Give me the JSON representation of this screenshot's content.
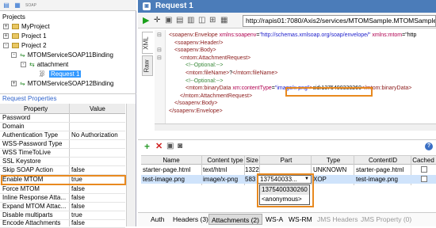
{
  "navigator": {
    "logo": "SOAP",
    "projects_label": "Projects",
    "tree": [
      {
        "label": "MyProject",
        "expander": "+"
      },
      {
        "label": "Project 1",
        "expander": "+"
      },
      {
        "label": "Project 2",
        "expander": "-"
      },
      {
        "label": "MTOMServiceSOAP11Binding",
        "expander": "-"
      },
      {
        "label": "attachment",
        "expander": "-"
      },
      {
        "label": "Request 1",
        "expander": ""
      },
      {
        "label": "MTOMServiceSOAP12Binding",
        "expander": "+"
      }
    ]
  },
  "properties": {
    "title": "Request Properties",
    "col_property": "Property",
    "col_value": "Value",
    "rows": [
      {
        "name": "Password",
        "value": ""
      },
      {
        "name": "Domain",
        "value": ""
      },
      {
        "name": "Authentication Type",
        "value": "No Authorization"
      },
      {
        "name": "WSS-Password Type",
        "value": ""
      },
      {
        "name": "WSS TimeToLive",
        "value": ""
      },
      {
        "name": "SSL Keystore",
        "value": ""
      },
      {
        "name": "Skip SOAP Action",
        "value": "false"
      },
      {
        "name": "Enable MTOM",
        "value": "true"
      },
      {
        "name": "Force MTOM",
        "value": "false"
      },
      {
        "name": "Inline Response Atta...",
        "value": "false"
      },
      {
        "name": "Expand MTOM Attac...",
        "value": "false"
      },
      {
        "name": "Disable multiparts",
        "value": "true"
      },
      {
        "name": "Encode Attachments",
        "value": "false"
      }
    ]
  },
  "request": {
    "title": "Request 1",
    "url": "http://rapis01:7080/Axis2/services/MTOMSample.MTOMSampleSO",
    "tabs": {
      "xml": "XML",
      "raw": "Raw"
    },
    "xml_lines": [
      {
        "indent": 0,
        "parts": [
          [
            "tag",
            "<soapenv:Envelope "
          ],
          [
            "att",
            "xmlns:soapenv"
          ],
          [
            "txt",
            "="
          ],
          [
            "val",
            "\"http://schemas.xmlsoap.org/soap/envelope/\""
          ],
          [
            "txt",
            " "
          ],
          [
            "att",
            "xmlns:mtom"
          ],
          [
            "txt",
            "=\"http"
          ]
        ]
      },
      {
        "indent": 1,
        "parts": [
          [
            "tag",
            "<soapenv:Header/>"
          ]
        ]
      },
      {
        "indent": 1,
        "parts": [
          [
            "tag",
            "<soapenv:Body>"
          ]
        ]
      },
      {
        "indent": 2,
        "parts": [
          [
            "tag",
            "<mtom:AttachmentRequest>"
          ]
        ]
      },
      {
        "indent": 3,
        "parts": [
          [
            "cmt",
            "<!--Optional:-->"
          ]
        ]
      },
      {
        "indent": 3,
        "parts": [
          [
            "tag",
            "<mtom:fileName>"
          ],
          [
            "txt",
            "?"
          ],
          [
            "tag",
            "</mtom:fileName>"
          ]
        ]
      },
      {
        "indent": 3,
        "parts": [
          [
            "cmt",
            "<!--Optional:-->"
          ]
        ]
      },
      {
        "indent": 3,
        "parts": [
          [
            "tag",
            "<mtom:binaryData "
          ],
          [
            "att",
            "xm:contentType"
          ],
          [
            "txt",
            "="
          ],
          [
            "val",
            "\"image/x-png\""
          ],
          [
            "tag",
            ">"
          ],
          [
            "txt",
            "cid:1375400330260"
          ],
          [
            "tag",
            "</mtom:binaryData>"
          ]
        ]
      },
      {
        "indent": 2,
        "parts": [
          [
            "tag",
            "</mtom:AttachmentRequest>"
          ]
        ]
      },
      {
        "indent": 1,
        "parts": [
          [
            "tag",
            "</soapenv:Body>"
          ]
        ]
      },
      {
        "indent": 0,
        "parts": [
          [
            "tag",
            "</soapenv:Envelope>"
          ]
        ]
      }
    ]
  },
  "attachments": {
    "columns": [
      "Name",
      "Content type",
      "Size",
      "Part",
      "Type",
      "ContentID",
      "Cached"
    ],
    "rows": [
      {
        "name": "starter-page.html",
        "content_type": "text/html",
        "size": "1322",
        "part": "",
        "type": "UNKNOWN",
        "content_id": "starter-page.html",
        "cached": false
      },
      {
        "name": "test-image.png",
        "content_type": "image/x-png",
        "size": "583",
        "part": "137540033...",
        "type": "XOP",
        "content_id": "test-image.png",
        "cached": false
      }
    ],
    "part_options": [
      "1375400330260",
      "<anonymous>"
    ]
  },
  "bottom_tabs": [
    {
      "label": "Auth",
      "state": "normal"
    },
    {
      "label": "Headers (3)",
      "state": "normal"
    },
    {
      "label": "Attachments (2)",
      "state": "active"
    },
    {
      "label": "WS-A",
      "state": "normal"
    },
    {
      "label": "WS-RM",
      "state": "normal"
    },
    {
      "label": "JMS Headers",
      "state": "disabled"
    },
    {
      "label": "JMS Property (0)",
      "state": "disabled"
    }
  ],
  "colors": {
    "accent": "#e8891f",
    "title_bar": "#4b7cb9",
    "selection": "#3399ff",
    "add": "#2a9a2a",
    "delete": "#d02020"
  }
}
